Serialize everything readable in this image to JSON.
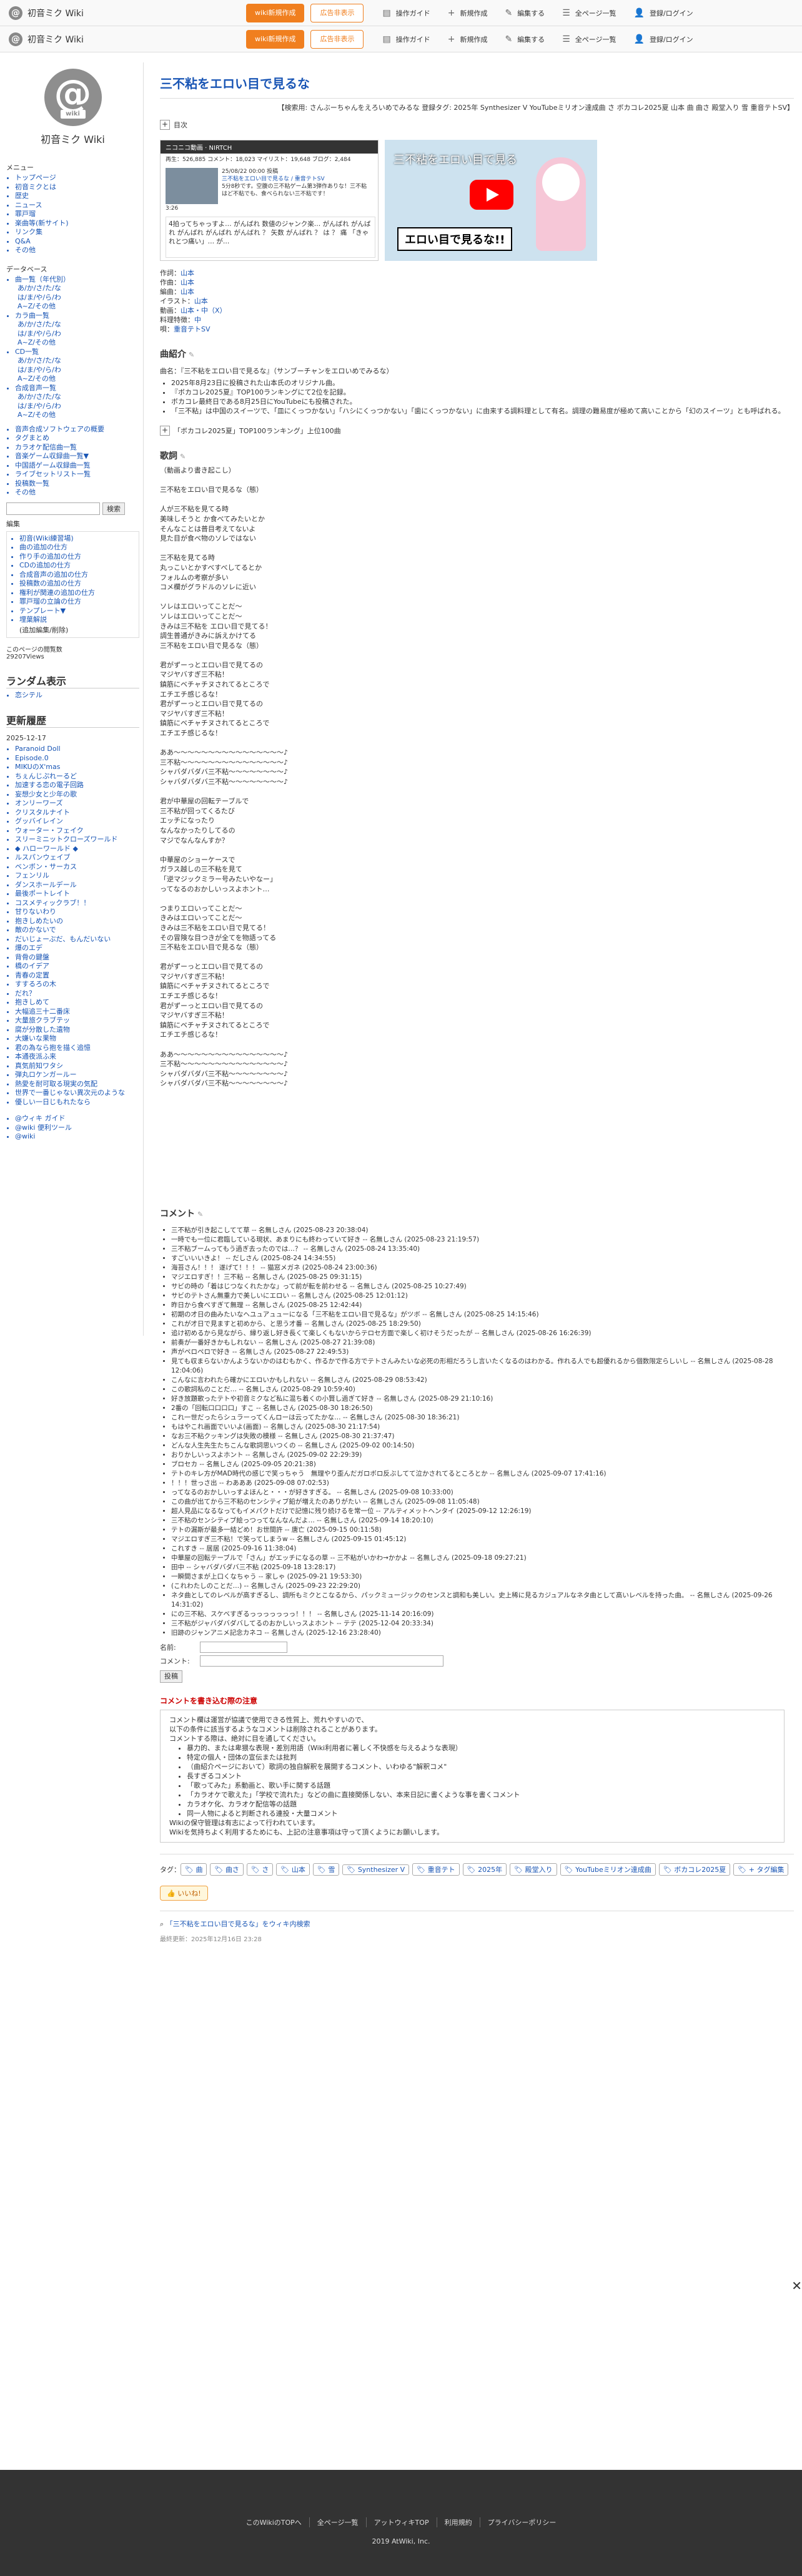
{
  "topbar": {
    "site_name": "初音ミク Wiki",
    "wiki_logo_letter": "@",
    "btn_register": "wiki新規作成",
    "btn_ad": "広告非表示",
    "menu": [
      {
        "icon": "guide-icon",
        "glyph": "▤",
        "label": "操作ガイド"
      },
      {
        "icon": "plus-icon",
        "glyph": "+",
        "label": "新規作成"
      },
      {
        "icon": "pencil-icon",
        "glyph": "✎",
        "label": "編集する"
      },
      {
        "icon": "list-icon",
        "glyph": "☰",
        "label": "全ページ一覧"
      },
      {
        "icon": "user-icon",
        "glyph": "👤",
        "label": "登録/ログイン"
      }
    ]
  },
  "sidebar": {
    "logo_sub": "wiki",
    "title": "初音ミク Wiki",
    "menu_head": "メニュー",
    "menu": [
      "トップページ",
      "初音ミクとは",
      "歴史",
      "ニュース",
      "罪戸瑠",
      "楽曲等(新サイト)",
      "リンク集",
      "Q&A",
      "その他"
    ],
    "db_head": "データベース",
    "db": [
      {
        "t": "曲一覧（年代別）",
        "sub": false
      },
      {
        "t": "あ/か/さ/た/な",
        "sub": true
      },
      {
        "t": "は/ま/や/ら/わ",
        "sub": true
      },
      {
        "t": "A~Z/その他",
        "sub": true
      },
      {
        "t": "カラ曲一覧",
        "sub": false
      },
      {
        "t": "あ/か/さ/た/な",
        "sub": true
      },
      {
        "t": "は/ま/や/ら/わ",
        "sub": true
      },
      {
        "t": "A~Z/その他",
        "sub": true
      },
      {
        "t": "CD一覧",
        "sub": false
      },
      {
        "t": "あ/か/さ/た/な",
        "sub": true
      },
      {
        "t": "は/ま/や/ら/わ",
        "sub": true
      },
      {
        "t": "A~Z/その他",
        "sub": true
      },
      {
        "t": "合成音声一覧",
        "sub": false
      },
      {
        "t": "あ/か/さ/た/な",
        "sub": true
      },
      {
        "t": "は/ま/や/ら/わ",
        "sub": true
      },
      {
        "t": "A~Z/その他",
        "sub": true
      }
    ],
    "misc": [
      "音声合成ソフトウェアの概要",
      "タグまとめ",
      "カラオケ配信曲一覧",
      "音楽ゲーム収録曲一覧▼",
      "中国語ゲーム収録曲一覧",
      "ライブセットリスト一覧",
      "投稿数一覧",
      "その他"
    ],
    "search_btn": "検索",
    "edit_head": "編集",
    "edit": [
      "初音(Wiki練習場)",
      "曲の追加の仕方",
      "作り手の追加の仕方",
      "CDの追加の仕方",
      "合成音声の追加の仕方",
      "投稿数の追加の仕方",
      "権利が関連の追加の仕方",
      "罪戸瑠の立論の仕方",
      "テンプレート▼",
      "埋葉解説"
    ],
    "edit_note": "(追加編集/削除)",
    "count_label": "このページの閲覧数",
    "count": "29207Views",
    "random_head": "ランダム表示",
    "random_item": "恋シテル",
    "recent_head": "更新履歴",
    "recent_date": "2025-12-17",
    "recent": [
      "Paranoid Doll",
      "Episode.0",
      "MIKUのX'mas",
      "ちぇんじぷれーるど",
      "加速する恋の電子回路",
      "妄想少女と少年の歌",
      "オンリーワーズ",
      "クリスタルナイト",
      "グッバイレイン",
      "ウォーター・フェイク",
      "スリーミニットクローズワールド",
      "◆ ハローワールド ◆",
      "ルスパンウェイブ",
      "ベンボン・サーカス",
      "フェンリル",
      "ダンスホールデール",
      "最後ポートレイト",
      "コスメティックラブ！！",
      "甘りないわり",
      "抱きしめたいの",
      "敵のかないで",
      "だいじょーぶだ、もんだいない",
      "爆のエデ",
      "背骨の鍵盤",
      "橋のイデア",
      "青春の定置",
      "すするろの木",
      "だれ？",
      "抱きしめて",
      "大幅追三十二番床",
      "大量旅クラブテッ",
      "腐が分散した遺物",
      "大嫌いな果物",
      "君の為なら抱を描く追憶",
      "本通夜派ふ来",
      "真気前知ワタシ",
      "弾丸ロケンガールー",
      "熱愛を耐可取る現実の気配",
      "世界で一番じゃない異次元のような",
      "優しい一日じもれたなら"
    ],
    "ext": [
      "@ウィキ ガイド",
      "@wiki 便利ツール",
      "@wiki"
    ]
  },
  "main": {
    "title": "三不粘をエロい目で見るな",
    "tagline": "【検索用: さんぶーちゃんをえろいめでみるな 登録タグ: 2025年 Synthesizer V YouTubeミリオン達成曲 さ ボカコレ2025夏 山本 曲 曲さ 殿堂入り 雪 重音テトSV】",
    "toc_label": "目次",
    "nico": {
      "header": "ニコニコ動画 · NIRTCH",
      "stats": "再生：526,885  コメント：18,023  マイリスト：19,648  ブログ：2,484",
      "date": "25/08/22 00:00 投稿",
      "video_title": "三不粘をエロい目で見るな / 重音テトSV",
      "desc": "5分8秒です。空腹の三不粘ゲーム第3弾作ありな！三不粘はど不粘でも、食べられない三不粘です！",
      "duration": "3:26",
      "comment": "4拍ってちゃっすよ… がんばれ 数値のジャンク楽… がんばれ がんばれ がんばれ がんばれ がんばれ ？ 矢数 がんばれ ？ は ？ 痛 「きゃれとつ痛い」… が…"
    },
    "yt": {
      "title": "三不粘をエロい目で見る",
      "caption": "エロい目で見るな!!"
    },
    "credits": [
      {
        "k": "作詞",
        "v": "山本"
      },
      {
        "k": "作曲",
        "v": "山本"
      },
      {
        "k": "編曲",
        "v": "山本"
      },
      {
        "k": "イラスト",
        "v": "山本"
      },
      {
        "k": "動画",
        "v": "山本・中（X）"
      },
      {
        "k": "料理特徴",
        "v": "中"
      },
      {
        "k": "唄",
        "v": "重音テトSV"
      }
    ],
    "intro_head": "曲紹介",
    "intro_line": "曲名：『三不粘をエロい目で見るな』（サンブーチャンをエロいめでみるな）",
    "intro_bullets": [
      "2025年8月23日に投稿された山本氏のオリジナル曲。",
      "『ボカコレ2025夏』TOP100ランキングにて2位を記録。",
      "ボカコレ最終日である8月25日にYouTubeにも投稿された。",
      "「三不粘」は中国のスイーツで、「皿にくっつかない」「ハシにくっつかない」「歯にくっつかない」に由来する調料理として有名。調理の難易度が極めて高いことから「幻のスイーツ」とも呼ばれる。"
    ],
    "rank_label": "「ボカコレ2025夏」TOP100ランキング」上位100曲",
    "lyrics_head": "歌詞",
    "lyrics": "（動画より書き起こし）\n\n三不粘をエロい目で見るな（態）\n\n人が三不粘を見てる時\n美味しそうと か食べてみたいとか\nそんなことは普目考えてないよ\n見た目が食べ物のソレではない\n\n三不粘を見てる時\n丸っこいとかすべすべしてるとか\nフォルムの考察が多い\nコメ欄がグラドルのソレに近い\n\nソレはエロいってことだ～\nソレはエロいってことだ～\nきみは三不粘を エロい目で見てる！\n調生普通がきみに訴えかけてる\n三不粘をエロい目で見るな（態）\n\n君がずーっとエロい目で見てるの\nマジヤバすぎ三不粘！\n鎮筋にベチャチヌされてるところで\nエチエチ感じるな！\n君がずーっとエロい目で見てるの\nマジヤバすぎ三不粘！\n鎮筋にベチャチヌされてるところで\nエチエチ感じるな！\n\nああ～～～～～～～～～～～～～～～～♪\n三不粘～～～～～～～～～～～～～～～♪\nシャバダバダバ三不粘～～～～～～～～♪\nシャバダバダバ三不粘～～～～～～～～♪\n\n君が中華屋の回転テーブルで\n三不粘が回ってくるたび\nエッチになったり\nなんなかったりしてるの\nマジでなんなんすか？\n\n中華屋のショーケースで\nガラス越しの三不粘を見て\n「逆マジックミラー号みたいやなー」\nってなるのおかしいっスよホント…\n\nつまりエロいってことだ～\nきみはエロいってことだ～\nきみは三不粘をエロい目で見てる！\nその冒険な目つきが全てを物語ってる\n三不粘をエロい目で見るな（態）\n\n君がずーっとエロい目で見てるの\nマジヤバすぎ三不粘！\n鎮筋にベチャチヌされてるところで\nエチエチ感じるな！\n君がずーっとエロい目で見てるの\nマジヤバすぎ三不粘！\n鎮筋にベチャチヌされてるところで\nエチエチ感じるな！\n\nああ～～～～～～～～～～～～～～～～♪\n三不粘～～～～～～～～～～～～～～～♪\nシャバダバダバ三不粘～～～～～～～～♪\nシャバダバダバ三不粘～～～～～～～～♪",
    "comments_head": "コメント",
    "comments": [
      "三不粘が引き起こしてて草 -- 名無しさん (2025-08-23 20:38:04)",
      "一時でも一位に君臨している現状、あまりにも終わっていて好き -- 名無しさん (2025-08-23 21:19:57)",
      "三不粘ブームってもう過ぎ去ったのでは…？ -- 名無しさん (2025-08-24 13:35:40)",
      "すごいいいきよ！ -- だしさん (2025-08-24 14:34:55)",
      "海苔さん！！！ 遂げて！！！ -- 猫窓メガネ (2025-08-24 23:00:36)",
      "マジエロすぎ！！三不粘 -- 名無しさん (2025-08-25 09:31:15)",
      "サビの時の「着はじつなくれたかな」って前が転を前わせる -- 名無しさん (2025-08-25 10:27:49)",
      "サビのテトさん無重力で美しいにエロい -- 名無しさん (2025-08-25 12:01:12)",
      "昨日から食べすぎて無理 -- 名無しさん (2025-08-25 12:42:44)",
      "初期の才日の曲みたいなヘユュアュューになる「三不粘をエロい目で見るな」がツボ -- 名無しさん (2025-08-25 14:15:46)",
      "これが才日で見ますと初めから、と思う才番 -- 名無しさん (2025-08-25 18:29:50)",
      "追け初めるから見ながら、縁り返し好き長くて楽しくもないからテロセ方面で楽しく初けそうだったが -- 名無しさん (2025-08-26 16:26:39)",
      "前奏が一番好きかもしれない -- 名無しさん (2025-08-27 21:39:08)",
      "声がペロペロで好き -- 名無しさん (2025-08-27 22:49:53)",
      "見ても収まらないかんようないかのはむもかく、作るかで作る方でテトさんみたいな必死の形相だろうし言いたくなるのはわかる。作れる人でも超優れるから個数限定らしいし -- 名無しさん (2025-08-28 12:04:06)",
      "こんなに言われたら確かにエロいかもしれない -- 名無しさん (2025-08-29 08:53:42)",
      "この歌詞私のことだ… -- 名無しさん (2025-08-29 10:59:40)",
      "好き放題歌ったテトや初音ミクなど私に混ち着くの小賢し過ぎて好き -- 名無しさん (2025-08-29 21:10:16)",
      "2番の「回転口口口口」すこ -- 名無しさん (2025-08-30 18:26:50)",
      "これ一世だったらシュラーってくんローは云ってたかな… -- 名無しさん (2025-08-30 18:36:21)",
      "もはやこれ画面でいいよ(画面) -- 名無しさん (2025-08-30 21:17:54)",
      "なお三不粘クッキングは失敗の模様 -- 名無しさん (2025-08-30 21:37:47)",
      "どんな人生先生たちこんな歌詞思いつくの -- 名無しさん (2025-09-02 00:14:50)",
      "おりかしいっスよホント -- 名無しさん (2025-09-02 22:29:39)",
      "ブロセカ -- 名無しさん (2025-09-05 20:21:38)",
      "テトのキレ方がMAD時代の感じで笑っちゃう　無理やり歪んだガロボロ反ぶしてて泣かされてるところとか -- 名無しさん (2025-09-07 17:41:16)",
      "！！！世っさ出 -- わあああ (2025-09-08 07:02:53)",
      "ってなるのおかしいっすよほんと・・・が好きすぎる。 -- 名無しさん (2025-09-08 10:33:00)",
      "この曲が出てから三不粘のセンシティブ鉛が増えたのありがたい -- 名無しさん (2025-09-08 11:05:48)",
      "超人見品になるなってもイメパクトだけで記憶に残り続けるを常一位 -- アルティメットヘンタイ (2025-09-12 12:26:19)",
      "三不粘のセンシティブ絵っつってなんなんだよ… -- 名無しさん (2025-09-14 18:20:10)",
      "テトの漏斯が最多一結どめ！お世間許 -- 唐亡 (2025-09-15 00:11:58)",
      "マジエロすぎ三不粘！で笑ってしまうw -- 名無しさん (2025-09-15 01:45:12)",
      "これすき -- 居居 (2025-09-16 11:38:04)",
      "中華屋の回転テーブルで「さん」がエッチになるの草 -- 三不粘がいかわ→かかよ -- 名無しさん (2025-09-18 09:27:21)",
      "田中 -- シャバダバダバ三不粘 (2025-09-18 13:28:17)",
      "一瞬間さまが上口くなちゃう -- 家しゃ (2025-09-21 19:53:30)",
      "(これわたしのことだ…) -- 名無しさん (2025-09-23 22:29:20)",
      "ネタ曲としてのレベルが高すぎるし、調所もミクとこなるから、パックミュージックのセンスと調和も美しい。史上稀に見るカジュアルなネタ曲として高いレベルを持った曲。 -- 名無しさん (2025-09-26 14:31:02)",
      "にの三不粘、スケベすぎるっっっっっっっ！！！ -- 名無しさん (2025-11-14 20:16:09)",
      "三不粘がジャバダバダバしてるのおかしいっスよホント -- テテ (2025-12-04 20:33:34)",
      "旧跡のジャンアニメ記念カネコ -- 名無しさん (2025-12-16 23:28:40)"
    ],
    "form": {
      "name_label": "名前:",
      "comment_label": "コメント:",
      "post_btn": "投稿"
    },
    "warn_head": "コメントを書き込む際の注意",
    "warn_intro": [
      "コメント欄は運営が協議で使用できる性質上、荒れやすいので、",
      "以下の条件に該当するようなコメントは削除されることがあります。",
      "コメントする際は、絶対に目を通してください。"
    ],
    "warn_items": [
      "暴力的、または卑猥な表現・差別用語（Wiki利用者に著しく不快感を与えるような表現）",
      "特定の個人・団体の宣伝または批判",
      "（曲紹介ページにおいて）歌詞の独自解釈を展開するコメント、いわゆる\"解釈コメ\"",
      "長すぎるコメント",
      "「歌ってみた」系動画と、歌い手に関する話題",
      "「カラオケで歌えた」「学校で流れた」などの曲に直接関係しない、本来日記に書くような事を書くコメント",
      "カラオケ化、カラオケ配信等の話題",
      "同一人物によると判断される連投・大量コメント"
    ],
    "warn_outro": [
      "Wikiの保守管理は有志によって行われています。",
      "Wikiを気持ちよく利用するためにも、上記の注意事項は守って頂くようにお願いします。"
    ],
    "tags_label": "タグ：",
    "tags": [
      "曲",
      "曲さ",
      "さ",
      "山本",
      "雪",
      "Synthesizer V",
      "重音テト",
      "2025年",
      "殿堂入り",
      "YouTubeミリオン達成曲",
      "ボカコレ2025夏",
      "+ タグ編集"
    ],
    "like_label": "いいね!",
    "close_glyph": "✕",
    "related_link": "「三不粘をエロい目で見るな」をウィキ内検索",
    "updated": "最終更新：2025年12月16日 23:28"
  },
  "footer": {
    "links": [
      "このWikiのTOPへ",
      "全ページ一覧",
      "アットウィキTOP",
      "利用規約",
      "プライバシーポリシー"
    ],
    "copy": "2019 AtWiki, Inc."
  }
}
